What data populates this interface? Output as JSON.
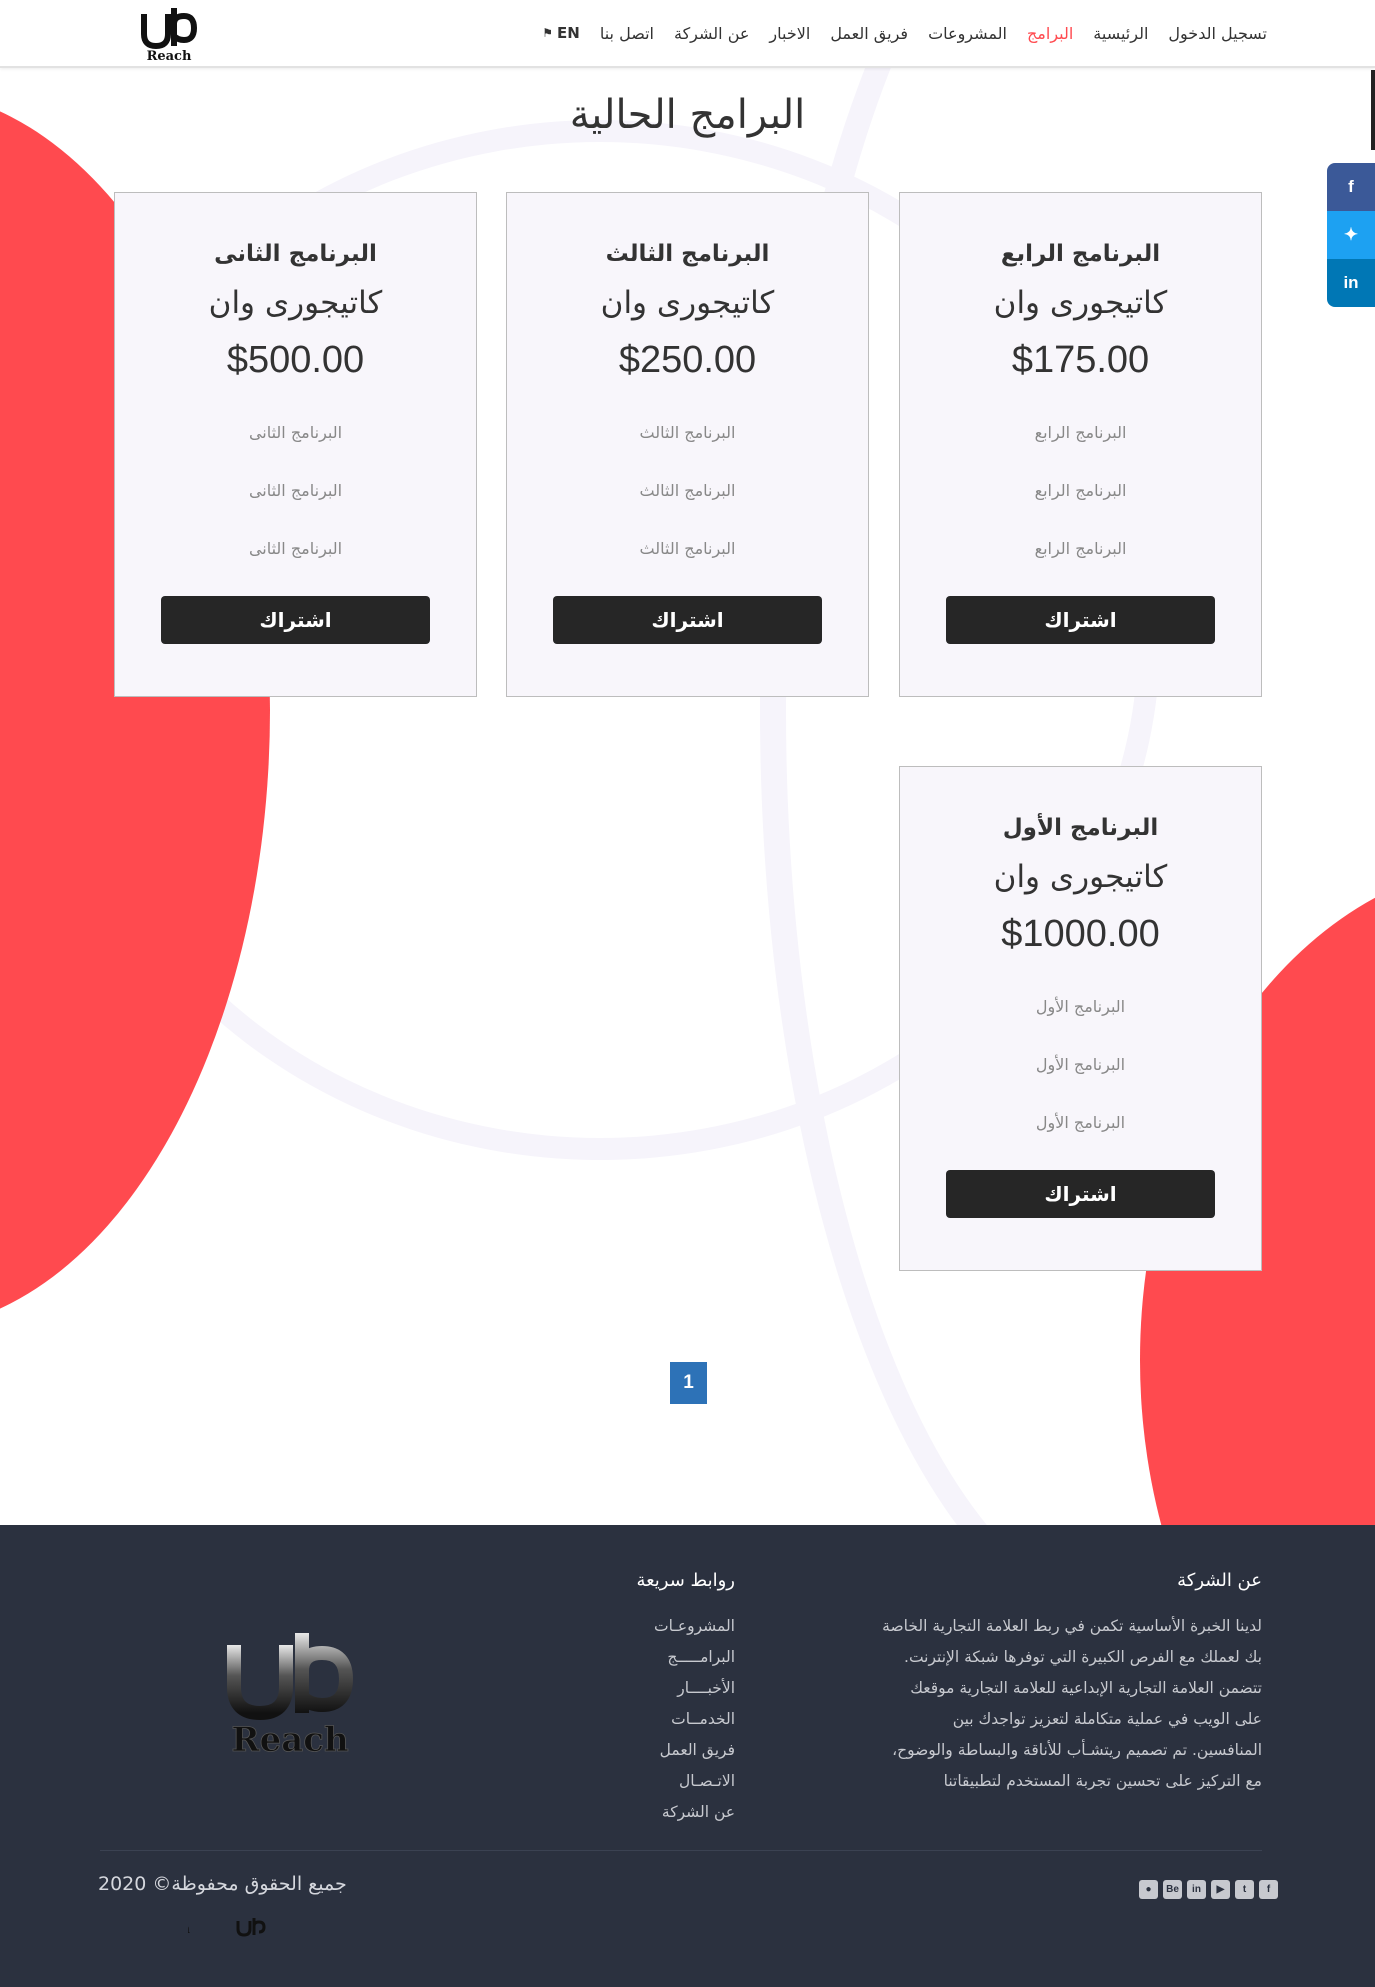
{
  "colors": {
    "accent": "#ff4a4f",
    "footer_bg": "#2b313f",
    "button_bg": "#262626",
    "pagination_bg": "#2d72b7"
  },
  "header": {
    "logo_text": "Reach",
    "nav": [
      {
        "label": "تسجيل الدخول"
      },
      {
        "label": "الرئيسية"
      },
      {
        "label": "البرامج"
      },
      {
        "label": "المشروعات"
      },
      {
        "label": "فريق العمل"
      },
      {
        "label": "الاخبار"
      },
      {
        "label": "عن الشركة"
      },
      {
        "label": "اتصل بنا"
      },
      {
        "label": "EN"
      }
    ]
  },
  "share": {
    "facebook": "f",
    "twitter": "t",
    "linkedin": "in"
  },
  "main": {
    "title": "البرامج الحالية",
    "cards": [
      {
        "name": "البرنامج الرابع",
        "category": "كاتيجورى وان",
        "price": "$175.00",
        "features": [
          "البرنامج الرابع",
          "البرنامج الرابع",
          "البرنامج الرابع"
        ],
        "button": "اشتراك"
      },
      {
        "name": "البرنامج الثالث",
        "category": "كاتيجورى وان",
        "price": "$250.00",
        "features": [
          "البرنامج الثالث",
          "البرنامج الثالث",
          "البرنامج الثالث"
        ],
        "button": "اشتراك"
      },
      {
        "name": "البرنامج الثانى",
        "category": "كاتيجورى وان",
        "price": "$500.00",
        "features": [
          "البرنامج الثانى",
          "البرنامج الثانى",
          "البرنامج الثانى"
        ],
        "button": "اشتراك"
      },
      {
        "name": "البرنامج الأول",
        "category": "كاتيجورى وان",
        "price": "$1000.00",
        "features": [
          "البرنامج الأول",
          "البرنامج الأول",
          "البرنامج الأول"
        ],
        "button": "اشتراك"
      }
    ],
    "pagination": {
      "current": "1"
    }
  },
  "footer": {
    "about_heading": "عن الشركة",
    "about_text": "لدينا الخبرة الأساسية تكمن في ربط العلامة التجارية الخاصة بك لعملك مع الفرص الكبيرة التي توفرها شبكة الإنترنت. تتضمن العلامة التجارية الإبداعية للعلامة التجارية موقعك على الويب في عملية متكاملة لتعزيز تواجدك بين المنافسين. تم تصميم ريتشـأب للأناقة والبساطة والوضوح، مع التركيز على تحسين تجربة المستخدم لتطبيقاتنا",
    "links_heading": "روابط سريعة",
    "links": [
      "المشروعـات",
      "البرامـــــج",
      "الأخبــــار",
      "الخدمــات",
      "فريق العمل",
      "الاتـصـال",
      "عن الشركة"
    ],
    "copyright": "جميع الحقوق محفوظة© 2020",
    "logo_text": "Reach",
    "social_icons": [
      "facebook-icon",
      "twitter-icon",
      "youtube-icon",
      "linkedin-icon",
      "behance-icon",
      "github-icon"
    ]
  }
}
